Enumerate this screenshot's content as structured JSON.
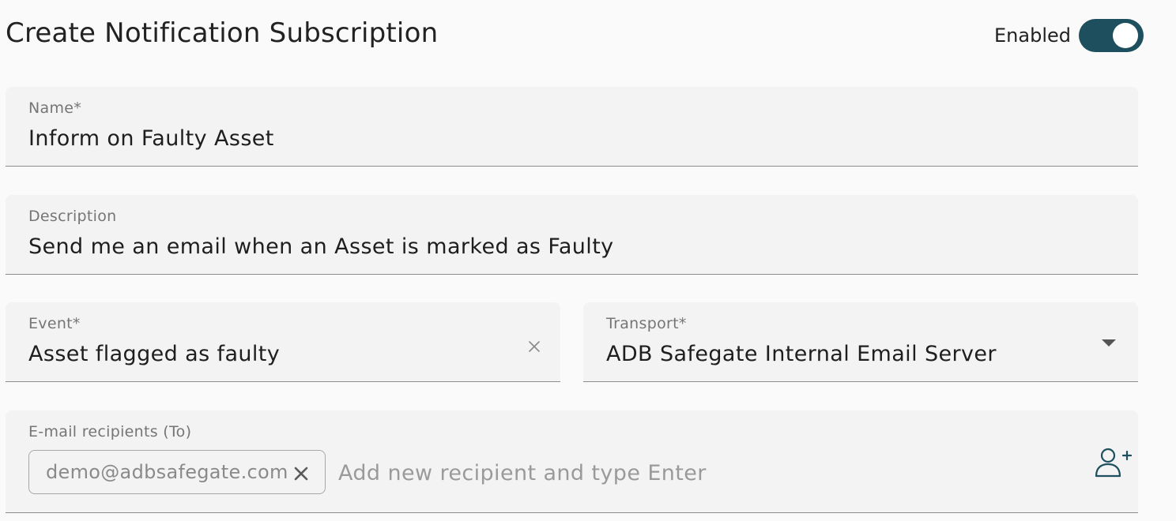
{
  "header": {
    "title": "Create Notification Subscription",
    "enabled_label": "Enabled",
    "enabled": true
  },
  "form": {
    "name": {
      "label": "Name*",
      "value": "Inform on Faulty Asset"
    },
    "description": {
      "label": "Description",
      "value": "Send me an email when an Asset is marked as Faulty"
    },
    "event": {
      "label": "Event*",
      "value": "Asset flagged as faulty",
      "clear_icon": "close-icon"
    },
    "transport": {
      "label": "Transport*",
      "value": "ADB Safegate Internal Email Server",
      "dropdown_icon": "chevron-down-icon"
    },
    "recipients": {
      "label": "E-mail recipients (To)",
      "chips": [
        "demo@adbsafegate.com"
      ],
      "placeholder": "Add new recipient and type Enter",
      "add_icon": "add-user-icon"
    }
  },
  "colors": {
    "accent": "#1d4f5e",
    "field_bg": "#f3f3f3",
    "page_bg": "#fafafa"
  }
}
